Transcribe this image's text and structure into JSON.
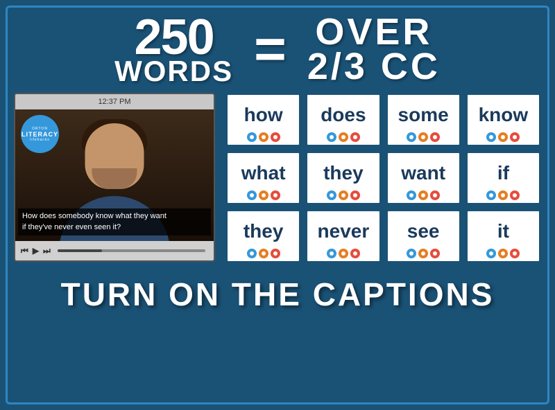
{
  "background_color": "#1a5276",
  "header": {
    "number": "250",
    "words_label": "WORDS",
    "equals": "=",
    "over_label": "OVER",
    "fraction_label": "2/3 CC"
  },
  "video": {
    "time": "12:37 PM",
    "caption_line1": "How does somebody know what they want",
    "caption_line2": "if they've never even seen it?",
    "logo": {
      "orton": "oRton",
      "literacy": "LITERACY",
      "lifehacks": "lifehacks"
    }
  },
  "word_cards": [
    {
      "id": "card-how",
      "word": "how",
      "icons": [
        "blue",
        "orange",
        "red"
      ]
    },
    {
      "id": "card-does",
      "word": "does",
      "icons": [
        "blue",
        "orange",
        "red"
      ]
    },
    {
      "id": "card-some",
      "word": "some",
      "icons": [
        "blue",
        "orange",
        "red"
      ]
    },
    {
      "id": "card-know",
      "word": "know",
      "icons": [
        "blue",
        "orange",
        "red"
      ]
    },
    {
      "id": "card-what",
      "word": "what",
      "icons": [
        "blue",
        "orange",
        "red"
      ]
    },
    {
      "id": "card-they1",
      "word": "they",
      "icons": [
        "blue",
        "orange",
        "red"
      ]
    },
    {
      "id": "card-want",
      "word": "want",
      "icons": [
        "blue",
        "orange",
        "red"
      ]
    },
    {
      "id": "card-if",
      "word": "if",
      "icons": [
        "blue",
        "orange",
        "red"
      ]
    },
    {
      "id": "card-they2",
      "word": "they",
      "icons": [
        "blue",
        "orange",
        "red"
      ]
    },
    {
      "id": "card-never",
      "word": "never",
      "icons": [
        "blue",
        "orange",
        "red"
      ]
    },
    {
      "id": "card-see",
      "word": "see",
      "icons": [
        "blue",
        "orange",
        "red"
      ]
    },
    {
      "id": "card-it",
      "word": "it",
      "icons": [
        "blue",
        "orange",
        "red"
      ]
    }
  ],
  "footer": {
    "text": "TURN ON THE CAPTIONS"
  }
}
